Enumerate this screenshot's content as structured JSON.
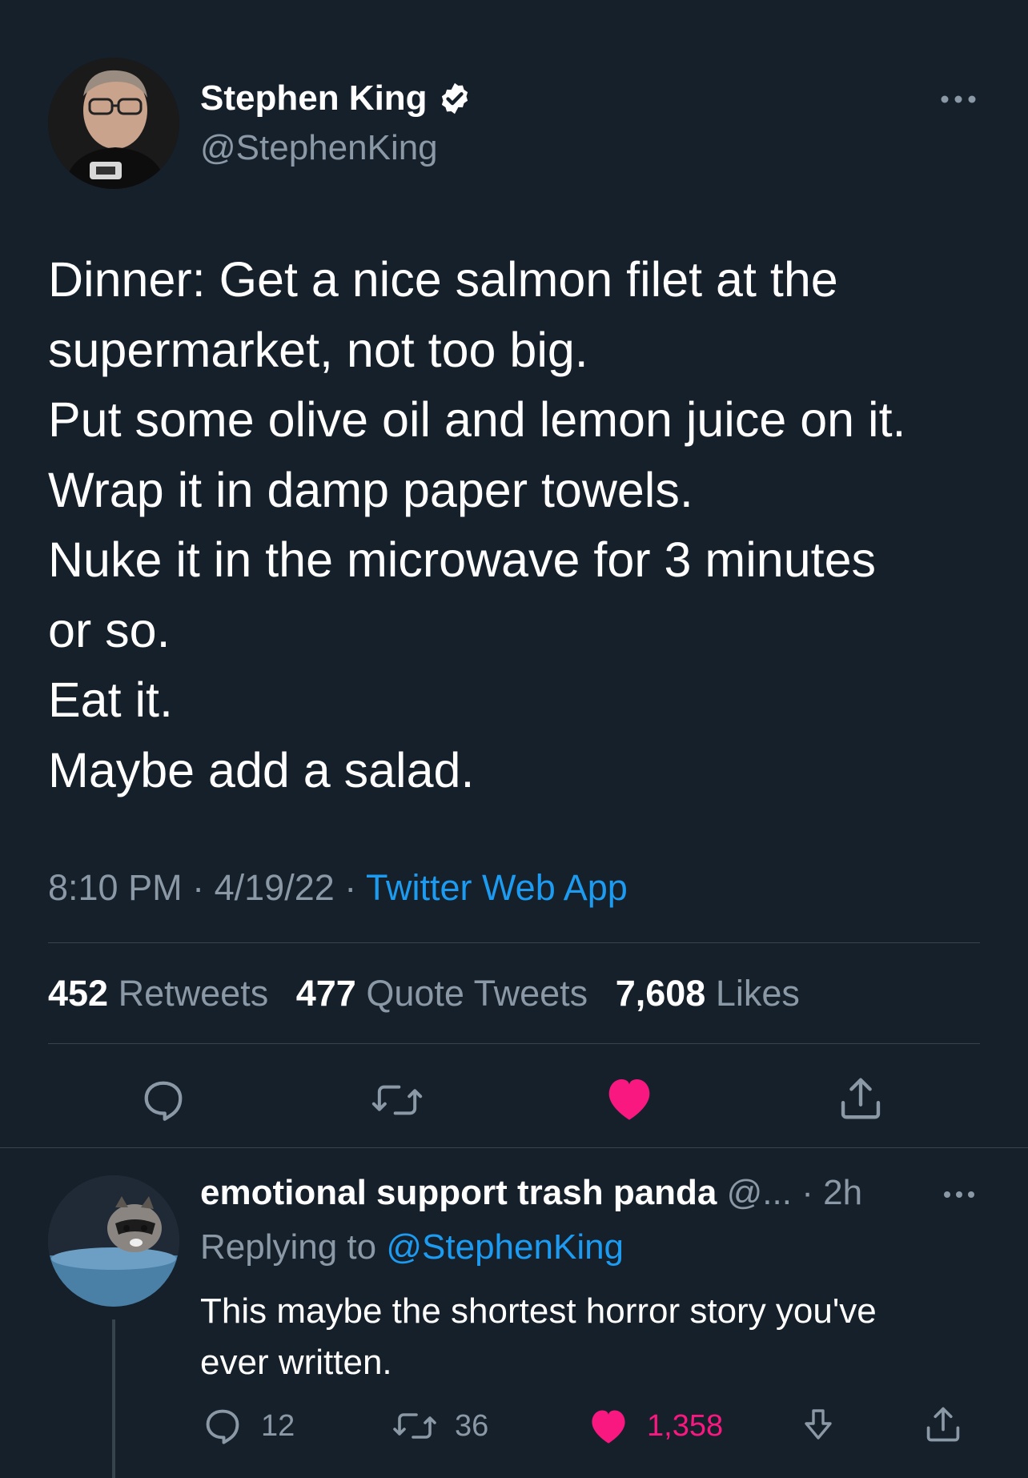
{
  "tweet": {
    "author": {
      "name": "Stephen King",
      "handle": "@StephenKing",
      "verified": true
    },
    "lines": [
      "Dinner: Get a nice salmon filet at the",
      "supermarket, not too big.",
      "Put some olive oil and lemon juice on it.",
      "Wrap it in damp paper towels.",
      "Nuke it in the microwave for 3 minutes",
      "or so.",
      "Eat it.",
      "Maybe add a salad."
    ],
    "time": "8:10 PM",
    "date": "4/19/22",
    "separator": "·",
    "source": "Twitter Web App",
    "stats": {
      "retweets_count": "452",
      "retweets_label": "Retweets",
      "quotes_count": "477",
      "quotes_label": "Quote Tweets",
      "likes_count": "7,608",
      "likes_label": "Likes"
    },
    "actions": [
      "reply-icon",
      "retweet-icon",
      "heart-icon",
      "share-icon"
    ],
    "liked": true
  },
  "reply": {
    "name": "emotional support trash panda",
    "handle_truncated": "@...",
    "separator": "·",
    "age": "2h",
    "replying_prefix": "Replying to",
    "replying_to": "@StephenKing",
    "text_lines": [
      "This maybe the shortest horror story you've",
      "ever written."
    ],
    "counts": {
      "replies": "12",
      "retweets": "36",
      "likes": "1,358"
    },
    "liked": true,
    "actions": [
      "reply-icon",
      "retweet-icon",
      "heart-icon",
      "downvote-icon",
      "share-icon"
    ]
  },
  "colors": {
    "background": "#15202b",
    "text": "#ffffff",
    "secondary": "#8b98a5",
    "link": "#1d9bf0",
    "like": "#f91880",
    "divider": "#38444d"
  }
}
